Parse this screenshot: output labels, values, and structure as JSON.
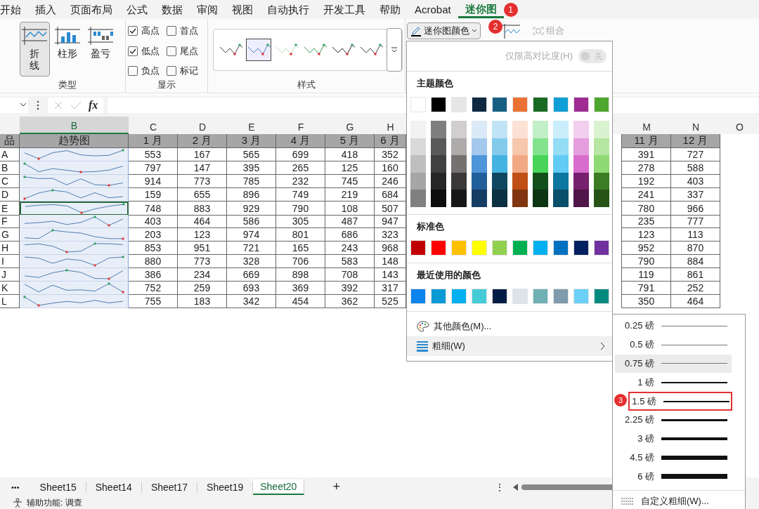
{
  "menu_tabs": [
    {
      "label": "开始",
      "selected": false
    },
    {
      "label": "插入",
      "selected": false
    },
    {
      "label": "页面布局",
      "selected": false
    },
    {
      "label": "公式",
      "selected": false
    },
    {
      "label": "数据",
      "selected": false
    },
    {
      "label": "审阅",
      "selected": false
    },
    {
      "label": "视图",
      "selected": false
    },
    {
      "label": "自动执行",
      "selected": false
    },
    {
      "label": "开发工具",
      "selected": false
    },
    {
      "label": "帮助",
      "selected": false
    },
    {
      "label": "Acrobat",
      "selected": false
    },
    {
      "label": "迷你图",
      "selected": true
    }
  ],
  "menu_badge": "1",
  "ribbon": {
    "type_group": {
      "label": "类型",
      "buttons": [
        {
          "label": "折线",
          "kind": "line",
          "selected": true
        },
        {
          "label": "柱形",
          "kind": "column",
          "selected": false
        },
        {
          "label": "盈亏",
          "kind": "winloss",
          "selected": false
        }
      ]
    },
    "show_group": {
      "label": "显示",
      "options": [
        {
          "label": "高点",
          "checked": true
        },
        {
          "label": "首点",
          "checked": false
        },
        {
          "label": "低点",
          "checked": true
        },
        {
          "label": "尾点",
          "checked": false
        },
        {
          "label": "负点",
          "checked": false
        },
        {
          "label": "标记",
          "checked": false
        }
      ]
    },
    "style_group": {
      "label": "样式",
      "styles": [
        {
          "selected": false,
          "color": "#444444"
        },
        {
          "selected": true,
          "color": "#4f7faf"
        },
        {
          "selected": false,
          "color": "#b9e0bb"
        },
        {
          "selected": false,
          "color": "#2e9e55"
        },
        {
          "selected": false,
          "color": "#2b2b2b"
        },
        {
          "selected": false,
          "color": "#3a3a3a"
        }
      ]
    },
    "color_button": {
      "label": "迷你图颜色",
      "badge": "2"
    },
    "group_button": {
      "label": "组合",
      "disabled": true
    }
  },
  "formula_bar": {
    "function_label": "fx"
  },
  "sheet": {
    "column_letters": [
      {
        "label": "B",
        "selected": true
      },
      {
        "label": "C",
        "selected": false
      },
      {
        "label": "D",
        "selected": false
      },
      {
        "label": "E",
        "selected": false
      },
      {
        "label": "F",
        "selected": false
      },
      {
        "label": "G",
        "selected": false
      },
      {
        "label": "H",
        "selected": false
      },
      {
        "label": "M",
        "selected": false
      },
      {
        "label": "N",
        "selected": false
      },
      {
        "label": "O",
        "selected": false
      }
    ],
    "header": [
      "品",
      "趋势图",
      "1 月",
      "2 月",
      "3 月",
      "4 月",
      "5 月",
      "6 月",
      "11 月",
      "12 月"
    ],
    "rows": [
      {
        "label": "A",
        "selected": false,
        "values": [
          "553",
          "167",
          "565",
          "699",
          "418",
          "352",
          "391",
          "727"
        ]
      },
      {
        "label": "B",
        "selected": false,
        "values": [
          "797",
          "147",
          "395",
          "265",
          "125",
          "160",
          "278",
          "588"
        ]
      },
      {
        "label": "C",
        "selected": false,
        "values": [
          "914",
          "773",
          "785",
          "232",
          "745",
          "246",
          "192",
          "403"
        ]
      },
      {
        "label": "D",
        "selected": false,
        "values": [
          "159",
          "655",
          "896",
          "749",
          "219",
          "684",
          "241",
          "337"
        ]
      },
      {
        "label": "E",
        "selected": true,
        "values": [
          "748",
          "883",
          "929",
          "790",
          "108",
          "507",
          "780",
          "966"
        ]
      },
      {
        "label": "F",
        "selected": false,
        "values": [
          "403",
          "464",
          "586",
          "305",
          "487",
          "947",
          "235",
          "777"
        ]
      },
      {
        "label": "G",
        "selected": false,
        "values": [
          "203",
          "123",
          "974",
          "801",
          "686",
          "323",
          "123",
          "113"
        ]
      },
      {
        "label": "H",
        "selected": false,
        "values": [
          "853",
          "951",
          "721",
          "165",
          "243",
          "968",
          "952",
          "870"
        ]
      },
      {
        "label": "I",
        "selected": false,
        "values": [
          "880",
          "773",
          "328",
          "706",
          "583",
          "148",
          "790",
          "884"
        ]
      },
      {
        "label": "J",
        "selected": false,
        "values": [
          "386",
          "234",
          "669",
          "898",
          "708",
          "143",
          "119",
          "861"
        ]
      },
      {
        "label": "K",
        "selected": false,
        "values": [
          "752",
          "259",
          "693",
          "369",
          "392",
          "317",
          "791",
          "252"
        ]
      },
      {
        "label": "L",
        "selected": false,
        "values": [
          "755",
          "183",
          "342",
          "454",
          "362",
          "525",
          "350",
          "464"
        ]
      }
    ]
  },
  "color_menu": {
    "contrast_label": "仅限高对比度(H)",
    "contrast_toggle": {
      "label": "关",
      "on": false
    },
    "theme_title": "主题颜色",
    "theme_colors": [
      {
        "color": "#ffffff"
      },
      {
        "color": "#000000"
      },
      {
        "color": "#e7e6e6"
      },
      {
        "color": "#0e2841"
      },
      {
        "color": "#156082"
      },
      {
        "color": "#e97132"
      },
      {
        "color": "#196b24"
      },
      {
        "color": "#0f9ed5"
      },
      {
        "color": "#a02b93"
      },
      {
        "color": "#4ea72e"
      }
    ],
    "theme_shades": [
      [
        {
          "color": "#f2f2f2"
        },
        {
          "color": "#7f7f7f"
        },
        {
          "color": "#d0cece"
        },
        {
          "color": "#dceaf7"
        },
        {
          "color": "#c0e4f5"
        },
        {
          "color": "#fbe2d5"
        },
        {
          "color": "#c1f0c8"
        },
        {
          "color": "#caeefb"
        },
        {
          "color": "#f2cfee"
        },
        {
          "color": "#d9f2d0"
        }
      ],
      [
        {
          "color": "#d9d9d9"
        },
        {
          "color": "#595959"
        },
        {
          "color": "#afabab"
        },
        {
          "color": "#a5c8ed"
        },
        {
          "color": "#83cbeb"
        },
        {
          "color": "#f7c7ac"
        },
        {
          "color": "#83e28e"
        },
        {
          "color": "#95dcf7"
        },
        {
          "color": "#e59edd"
        },
        {
          "color": "#b5e6a2"
        }
      ],
      [
        {
          "color": "#bfbfbf"
        },
        {
          "color": "#404040"
        },
        {
          "color": "#757171"
        },
        {
          "color": "#4e95d9"
        },
        {
          "color": "#44b3e1"
        },
        {
          "color": "#f1a983"
        },
        {
          "color": "#47d459"
        },
        {
          "color": "#61cbf3"
        },
        {
          "color": "#d86dcd"
        },
        {
          "color": "#8ed973"
        }
      ],
      [
        {
          "color": "#a6a6a6"
        },
        {
          "color": "#262626"
        },
        {
          "color": "#3a3838"
        },
        {
          "color": "#215f9a"
        },
        {
          "color": "#0f4761"
        },
        {
          "color": "#c04f15"
        },
        {
          "color": "#124f1a"
        },
        {
          "color": "#0b76a0"
        },
        {
          "color": "#77206d"
        },
        {
          "color": "#3b7d23"
        }
      ],
      [
        {
          "color": "#808080"
        },
        {
          "color": "#0d0d0d"
        },
        {
          "color": "#171616"
        },
        {
          "color": "#153d64"
        },
        {
          "color": "#0b3041"
        },
        {
          "color": "#803510"
        },
        {
          "color": "#0c3512"
        },
        {
          "color": "#074f6a"
        },
        {
          "color": "#501549"
        },
        {
          "color": "#275317"
        }
      ]
    ],
    "standard_title": "标准色",
    "standard_colors": [
      {
        "color": "#c00000"
      },
      {
        "color": "#ff0000"
      },
      {
        "color": "#ffc000"
      },
      {
        "color": "#ffff00"
      },
      {
        "color": "#92d050"
      },
      {
        "color": "#00b050"
      },
      {
        "color": "#00b0f0"
      },
      {
        "color": "#0070c0"
      },
      {
        "color": "#002060"
      },
      {
        "color": "#7030a0"
      }
    ],
    "recent_title": "最近使用的颜色",
    "recent_colors": [
      {
        "color": "#0b84ee"
      },
      {
        "color": "#0b9ad6"
      },
      {
        "color": "#00b0f0"
      },
      {
        "color": "#44ccd6"
      },
      {
        "color": "#001e45"
      },
      {
        "color": "#dbe4e8"
      },
      {
        "color": "#6fb0b5"
      },
      {
        "color": "#7f9aac"
      },
      {
        "color": "#6bd0f7"
      },
      {
        "color": "#008a7e"
      }
    ],
    "more_colors": "其他颜色(M)...",
    "weight": {
      "label": "粗细(W)",
      "expanded": true
    }
  },
  "weight_menu": {
    "badge": "3",
    "items": [
      {
        "label": "0.25 磅",
        "selected": false,
        "marked": false
      },
      {
        "label": "0.5 磅",
        "selected": false,
        "marked": false
      },
      {
        "label": "0.75 磅",
        "selected": true,
        "marked": false
      },
      {
        "label": "1 磅",
        "selected": false,
        "marked": false
      },
      {
        "label": "1.5 磅",
        "selected": false,
        "marked": true
      },
      {
        "label": "2.25 磅",
        "selected": false,
        "marked": false
      },
      {
        "label": "3 磅",
        "selected": false,
        "marked": false
      },
      {
        "label": "4.5 磅",
        "selected": false,
        "marked": false
      },
      {
        "label": "6 磅",
        "selected": false,
        "marked": false
      }
    ],
    "custom": "自定义粗细(W)..."
  },
  "sheet_tabs": {
    "more": "•••",
    "tabs": [
      {
        "label": "Sheet15",
        "selected": false
      },
      {
        "label": "Sheet14",
        "selected": false
      },
      {
        "label": "Sheet17",
        "selected": false
      },
      {
        "label": "Sheet19",
        "selected": false
      },
      {
        "label": "Sheet20",
        "selected": true
      }
    ],
    "add": "+",
    "options": "⋮"
  },
  "status_bar": {
    "text": "辅助功能: 调查"
  }
}
